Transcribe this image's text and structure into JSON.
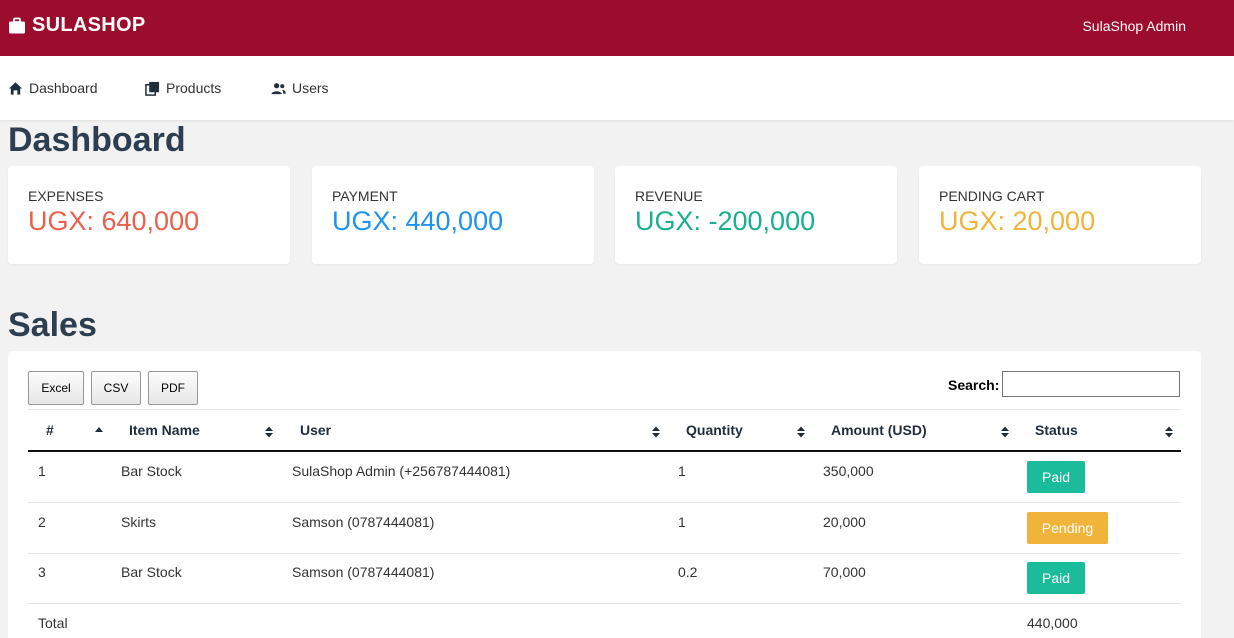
{
  "header": {
    "brand": "SULASHOP",
    "user": "SulaShop Admin"
  },
  "nav": {
    "dashboard": "Dashboard",
    "products": "Products",
    "users": "Users"
  },
  "page_title": "Dashboard",
  "cards": [
    {
      "label": "EXPENSES",
      "value": "UGX: 640,000",
      "color": "#e9604d"
    },
    {
      "label": "PAYMENT",
      "value": "UGX: 440,000",
      "color": "#1e95e8"
    },
    {
      "label": "REVENUE",
      "value": "UGX: -200,000",
      "color": "#1aaf8d"
    },
    {
      "label": "PENDING CART",
      "value": "UGX: 20,000",
      "color": "#f0b43a"
    }
  ],
  "sales": {
    "title": "Sales",
    "buttons": {
      "excel": "Excel",
      "csv": "CSV",
      "pdf": "PDF"
    },
    "search_label": "Search:",
    "search_value": "",
    "columns": [
      "#",
      "Item Name",
      "User",
      "Quantity",
      "Amount (USD)",
      "Status"
    ],
    "rows": [
      {
        "num": "1",
        "item": "Bar Stock",
        "user": "SulaShop Admin (+256787444081)",
        "qty": "1",
        "amount": "350,000",
        "status": "Paid"
      },
      {
        "num": "2",
        "item": "Skirts",
        "user": "Samson (0787444081)",
        "qty": "1",
        "amount": "20,000",
        "status": "Pending"
      },
      {
        "num": "3",
        "item": "Bar Stock",
        "user": "Samson (0787444081)",
        "qty": "0.2",
        "amount": "70,000",
        "status": "Paid"
      }
    ],
    "total_label": "Total",
    "total_value": "440,000"
  },
  "colors": {
    "topbar": "#9c0c2d",
    "paid": "#1abc9c",
    "pending": "#f0b43a"
  },
  "icons": {
    "brand": "briefcase-icon",
    "dashboard": "home-icon",
    "products": "books-icon",
    "users": "users-icon"
  }
}
